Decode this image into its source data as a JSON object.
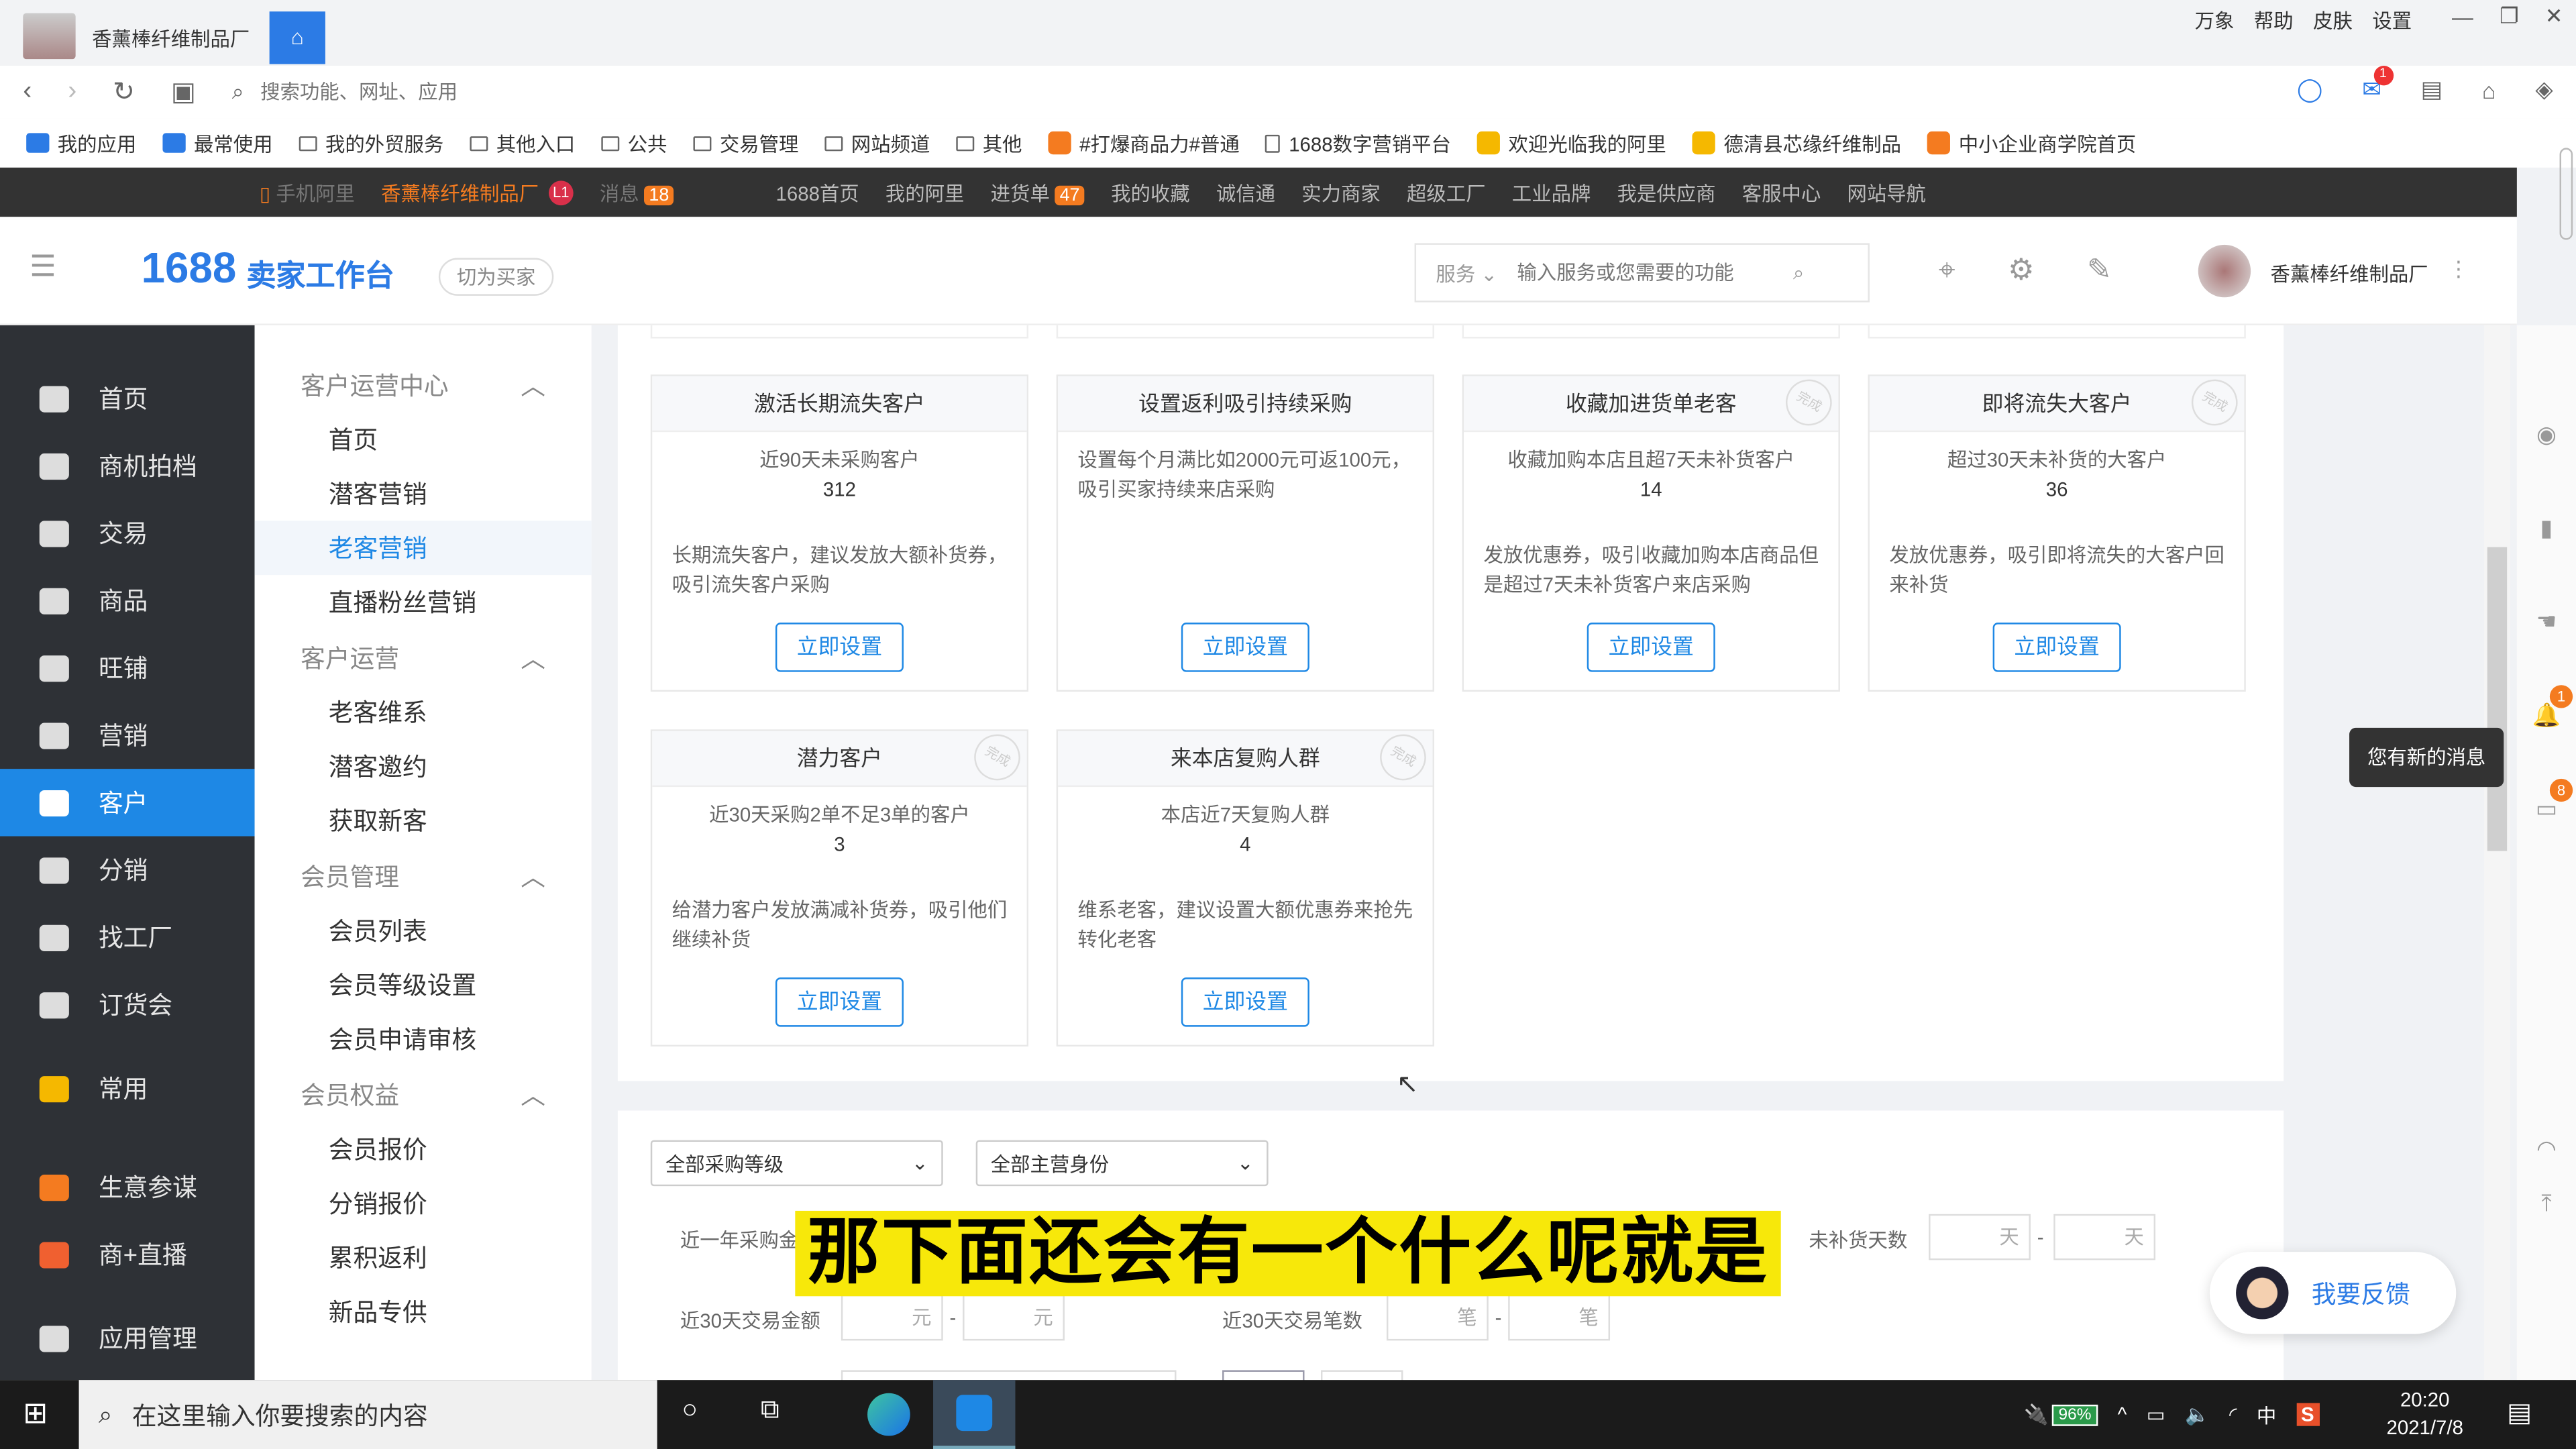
{
  "titlebar": {
    "tab_title": "香薰棒纤维制品厂",
    "right_links": [
      "万象",
      "帮助",
      "皮肤",
      "设置"
    ]
  },
  "addressbar": {
    "placeholder": "搜索功能、网址、应用",
    "mail_badge": "1"
  },
  "bookmarks": [
    {
      "label": "我的应用",
      "icon": "app-icon"
    },
    {
      "label": "最常使用",
      "icon": "app-icon"
    },
    {
      "label": "我的外贸服务",
      "icon": "folder-icon"
    },
    {
      "label": "其他入口",
      "icon": "folder-icon"
    },
    {
      "label": "公共",
      "icon": "folder-icon"
    },
    {
      "label": "交易管理",
      "icon": "folder-icon"
    },
    {
      "label": "网站频道",
      "icon": "folder-icon"
    },
    {
      "label": "其他",
      "icon": "folder-icon"
    },
    {
      "label": "#打爆商品力#普通",
      "icon": "site-icon"
    },
    {
      "label": "1688数字营销平台",
      "icon": "page-icon"
    },
    {
      "label": "欢迎光临我的阿里",
      "icon": "site-icon"
    },
    {
      "label": "德清县芯缘纤维制品",
      "icon": "site-icon"
    },
    {
      "label": "中小企业商学院首页",
      "icon": "site-icon"
    }
  ],
  "topnav": {
    "mobile": "手机阿里",
    "shop": "香薰棒纤维制品厂",
    "level": "L1",
    "messages": "消息",
    "messages_count": "18",
    "items": [
      "1688首页",
      "我的阿里",
      "进货单",
      "我的收藏",
      "诚信通",
      "实力商家",
      "超级工厂",
      "工业品牌",
      "我是供应商",
      "客服中心",
      "网站导航"
    ],
    "cart_count": "47"
  },
  "header": {
    "logo_num": "1688",
    "logo_text": "卖家工作台",
    "switch": "切为买家",
    "service": "服务",
    "search_placeholder": "输入服务或您需要的功能",
    "account": "香薰棒纤维制品厂"
  },
  "sidebar": [
    {
      "label": "首页"
    },
    {
      "label": "商机拍档"
    },
    {
      "label": "交易"
    },
    {
      "label": "商品"
    },
    {
      "label": "旺铺"
    },
    {
      "label": "营销"
    },
    {
      "label": "客户",
      "active": true
    },
    {
      "label": "分销"
    },
    {
      "label": "找工厂"
    },
    {
      "label": "订货会"
    },
    {
      "label": "常用"
    },
    {
      "label": "生意参谋"
    },
    {
      "label": "商+直播"
    },
    {
      "label": "应用管理"
    }
  ],
  "subnav": [
    {
      "group": "客户运营中心",
      "items": [
        "首页",
        "潜客营销",
        "老客营销",
        "直播粉丝营销"
      ]
    },
    {
      "group": "客户运营",
      "items": [
        "老客维系",
        "潜客邀约",
        "获取新客"
      ]
    },
    {
      "group": "会员管理",
      "items": [
        "会员列表",
        "会员等级设置",
        "会员申请审核"
      ]
    },
    {
      "group": "会员权益",
      "items": [
        "会员报价",
        "分销报价",
        "累积返利",
        "新品专供"
      ]
    }
  ],
  "subnav_active": "老客营销",
  "cards": [
    {
      "title": "激活长期流失客户",
      "desc": "近90天未采购客户",
      "count": "312",
      "tip": "长期流失客户，建议发放大额补货券，吸引流失客户采购",
      "button": "立即设置",
      "stamp": false
    },
    {
      "title": "设置返利吸引持续采购",
      "desc": "设置每个月满比如2000元可返100元，吸引买家持续来店采购",
      "count": "",
      "tip": "",
      "button": "立即设置",
      "stamp": false
    },
    {
      "title": "收藏加进货单老客",
      "desc": "收藏加购本店且超7天未补货客户",
      "count": "14",
      "tip": "发放优惠券，吸引收藏加购本店商品但是超过7天未补货客户来店采购",
      "button": "立即设置",
      "stamp": true
    },
    {
      "title": "即将流失大客户",
      "desc": "超过30天未补货的大客户",
      "count": "36",
      "tip": "发放优惠券，吸引即将流失的大客户回来补货",
      "button": "立即设置",
      "stamp": true
    },
    {
      "title": "潜力客户",
      "desc": "近30天采购2单不足3单的客户",
      "count": "3",
      "tip": "给潜力客户发放满减补货券，吸引他们继续补货",
      "button": "立即设置",
      "stamp": true
    },
    {
      "title": "来本店复购人群",
      "desc": "本店近7天复购人群",
      "count": "4",
      "tip": "维系老客，建议设置大额优惠券来抢先转化老客",
      "button": "立即设置",
      "stamp": true
    }
  ],
  "stamp_text": "完成",
  "filters": {
    "level": "全部采购等级",
    "identity": "全部主营身份",
    "year_amount": "近一年采购金",
    "no_restock": "未补货天数",
    "day_unit": "天",
    "amount30": "近30天交易金额",
    "yuan": "元",
    "count30": "近30天交易笔数",
    "bi": "笔"
  },
  "subtitle": "那下面还会有一个什么呢就是",
  "toast": "您有新的消息",
  "right_badges": [
    "1",
    "8"
  ],
  "feedback": "我要反馈",
  "taskbar": {
    "search_placeholder": "在这里输入你要搜索的内容",
    "battery": "96%",
    "ime": "中",
    "time": "20:20",
    "date": "2021/7/8"
  }
}
